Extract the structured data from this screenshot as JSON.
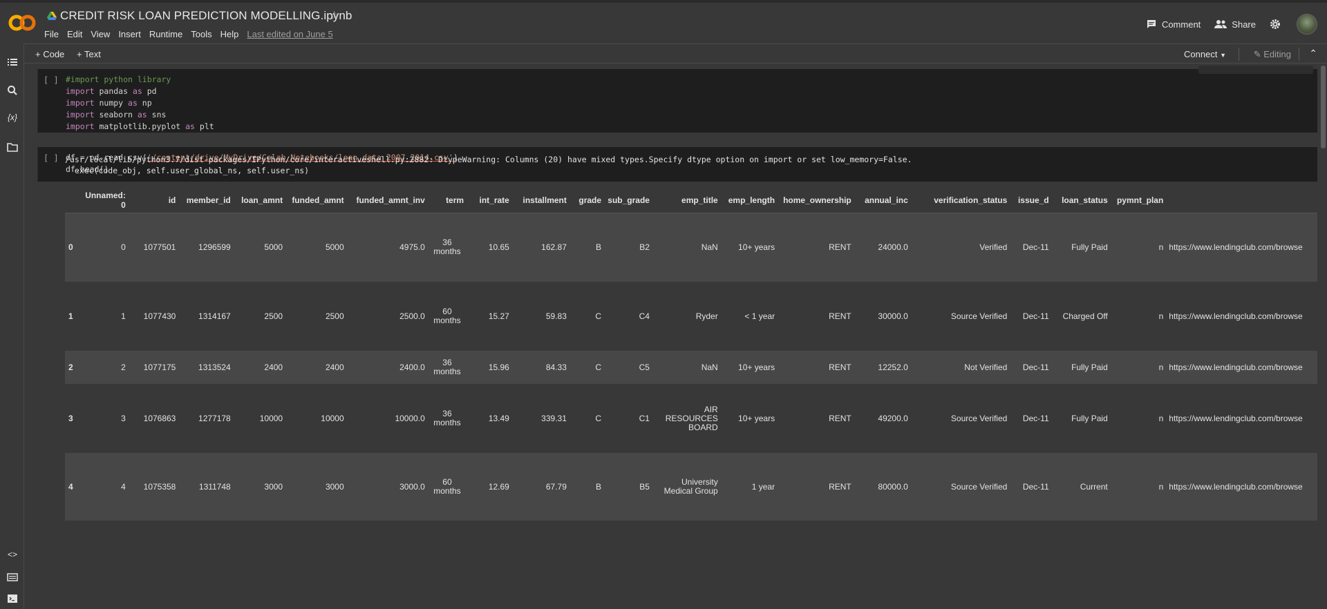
{
  "header": {
    "title": "CREDIT RISK LOAN PREDICTION MODELLING.ipynb",
    "menu": [
      "File",
      "Edit",
      "View",
      "Insert",
      "Runtime",
      "Tools",
      "Help"
    ],
    "last_edited": "Last edited on June 5",
    "comment_label": "Comment",
    "share_label": "Share"
  },
  "toolbar": {
    "add_code": "+ Code",
    "add_text": "+ Text",
    "connect": "Connect",
    "editing": "Editing"
  },
  "cells": [
    {
      "bracket": "[ ]",
      "lines": [
        "#import python library",
        "import pandas as pd",
        "import numpy as np",
        "import seaborn as sns",
        "import matplotlib.pyplot as plt"
      ]
    },
    {
      "bracket": "[ ]",
      "line1_prefix": "df = pd.read_csv(",
      "line1_string": "'/content/drive/MyDrive/Colab Notebooks/loan_data_2007_2014.csv'",
      "line1_suffix": ")",
      "line2": "df.head()"
    }
  ],
  "output": {
    "warning_line1": "/usr/local/lib/python3.7/dist-packages/IPython/core/interactiveshell.py:2882: DtypeWarning: Columns (20) have mixed types.Specify dtype option on import or set low_memory=False.",
    "warning_line2": "  exec(code_obj, self.user_global_ns, self.user_ns)",
    "columns": [
      "Unnamed: 0",
      "id",
      "member_id",
      "loan_amnt",
      "funded_amnt",
      "funded_amnt_inv",
      "term",
      "int_rate",
      "installment",
      "grade",
      "sub_grade",
      "emp_title",
      "emp_length",
      "home_ownership",
      "annual_inc",
      "verification_status",
      "issue_d",
      "loan_status",
      "pymnt_plan",
      ""
    ],
    "rows": [
      [
        "0",
        "0",
        "1077501",
        "1296599",
        "5000",
        "5000",
        "4975.0",
        "36 months",
        "10.65",
        "162.87",
        "B",
        "B2",
        "NaN",
        "10+ years",
        "RENT",
        "24000.0",
        "Verified",
        "Dec-11",
        "Fully Paid",
        "n",
        "https://www.lendingclub.com/browse"
      ],
      [
        "1",
        "1",
        "1077430",
        "1314167",
        "2500",
        "2500",
        "2500.0",
        "60 months",
        "15.27",
        "59.83",
        "C",
        "C4",
        "Ryder",
        "< 1 year",
        "RENT",
        "30000.0",
        "Source Verified",
        "Dec-11",
        "Charged Off",
        "n",
        "https://www.lendingclub.com/browse"
      ],
      [
        "2",
        "2",
        "1077175",
        "1313524",
        "2400",
        "2400",
        "2400.0",
        "36 months",
        "15.96",
        "84.33",
        "C",
        "C5",
        "NaN",
        "10+ years",
        "RENT",
        "12252.0",
        "Not Verified",
        "Dec-11",
        "Fully Paid",
        "n",
        "https://www.lendingclub.com/browse"
      ],
      [
        "3",
        "3",
        "1076863",
        "1277178",
        "10000",
        "10000",
        "10000.0",
        "36 months",
        "13.49",
        "339.31",
        "C",
        "C1",
        "AIR RESOURCES BOARD",
        "10+ years",
        "RENT",
        "49200.0",
        "Source Verified",
        "Dec-11",
        "Fully Paid",
        "n",
        "https://www.lendingclub.com/browse"
      ],
      [
        "4",
        "4",
        "1075358",
        "1311748",
        "3000",
        "3000",
        "3000.0",
        "60 months",
        "12.69",
        "67.79",
        "B",
        "B5",
        "University Medical Group",
        "1 year",
        "RENT",
        "80000.0",
        "Source Verified",
        "Dec-11",
        "Current",
        "n",
        "https://www.lendingclub.com/browse"
      ]
    ]
  }
}
